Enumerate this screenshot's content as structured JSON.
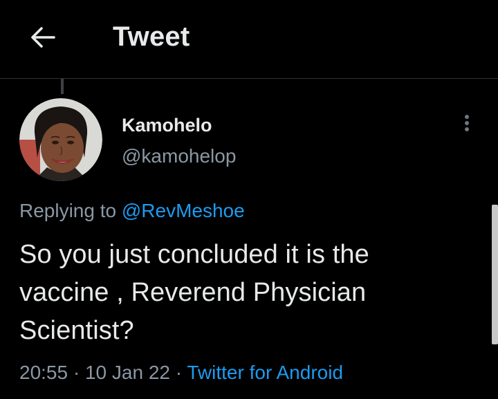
{
  "header": {
    "back_icon": "arrow-left-icon",
    "title": "Tweet"
  },
  "tweet": {
    "author": {
      "display_name": "Kamohelo",
      "handle": "@kamohelop"
    },
    "more_icon": "more-vertical-icon",
    "replying_to": {
      "prefix": "Replying to",
      "mention": "@RevMeshoe"
    },
    "text_lines": [
      "So you just concluded it is the",
      "vaccine , Reverend Physician",
      "Scientist?"
    ],
    "meta": {
      "time": "20:55",
      "separator": "·",
      "date": "10 Jan 22",
      "source": "Twitter for Android"
    }
  },
  "colors": {
    "background": "#000000",
    "text_primary": "#e7e9ea",
    "text_secondary": "#8b98a5",
    "accent": "#1d9bf0",
    "divider": "#2f3336"
  }
}
